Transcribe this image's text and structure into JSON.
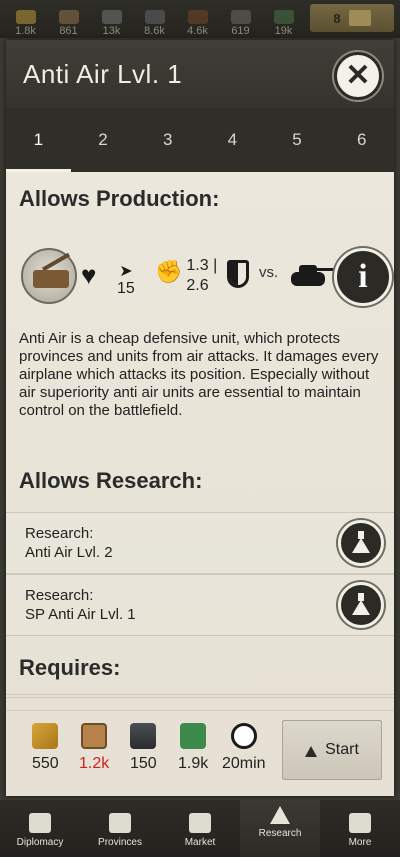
{
  "resources": [
    {
      "icon": "grain-icon",
      "value": "1.8k",
      "color": "#c7a43c"
    },
    {
      "icon": "goods-icon",
      "value": "861",
      "color": "#9a7a4c"
    },
    {
      "icon": "metal-icon",
      "value": "13k",
      "color": "#7a7d80"
    },
    {
      "icon": "steel-icon",
      "value": "8.6k",
      "color": "#6a6c70"
    },
    {
      "icon": "oil-icon",
      "value": "4.6k",
      "color": "#7a4a2a"
    },
    {
      "icon": "rare-materials-icon",
      "value": "619",
      "color": "#707070"
    },
    {
      "icon": "money-icon",
      "value": "19k",
      "color": "#4a7a4a"
    }
  ],
  "gold": {
    "value": "8"
  },
  "dialog": {
    "title": "Anti Air Lvl. 1",
    "tabs": [
      "1",
      "2",
      "3",
      "4",
      "5",
      "6"
    ],
    "active_tab": "1"
  },
  "production": {
    "heading": "Allows Production:",
    "speed": "15",
    "attack_line1": "1.3 |",
    "attack_line2": "2.6",
    "vs_label": "vs.",
    "description": "Anti Air is a cheap defensive unit, which protects provinces and units from air attacks. It damages every airplane which attacks its position. Especially without air superiority anti air units are essential to maintain control on the battlefield."
  },
  "research": {
    "heading": "Allows Research:",
    "items": [
      {
        "label": "Research:",
        "name": "Anti Air Lvl. 2"
      },
      {
        "label": "Research:",
        "name": "SP Anti Air Lvl. 1"
      }
    ]
  },
  "requires": {
    "heading": "Requires:"
  },
  "costs": {
    "grain": "550",
    "goods": "1.2k",
    "steel": "150",
    "money": "1.9k",
    "time": "20min",
    "goods_color": "#d11f1f"
  },
  "start_button": {
    "label": "Start"
  },
  "nav": [
    {
      "label": "Diplomacy",
      "icon": "diplomacy-icon"
    },
    {
      "label": "Provinces",
      "icon": "provinces-icon"
    },
    {
      "label": "Market",
      "icon": "market-icon"
    },
    {
      "label": "Research",
      "icon": "research-icon"
    },
    {
      "label": "More",
      "icon": "menu-icon"
    }
  ]
}
